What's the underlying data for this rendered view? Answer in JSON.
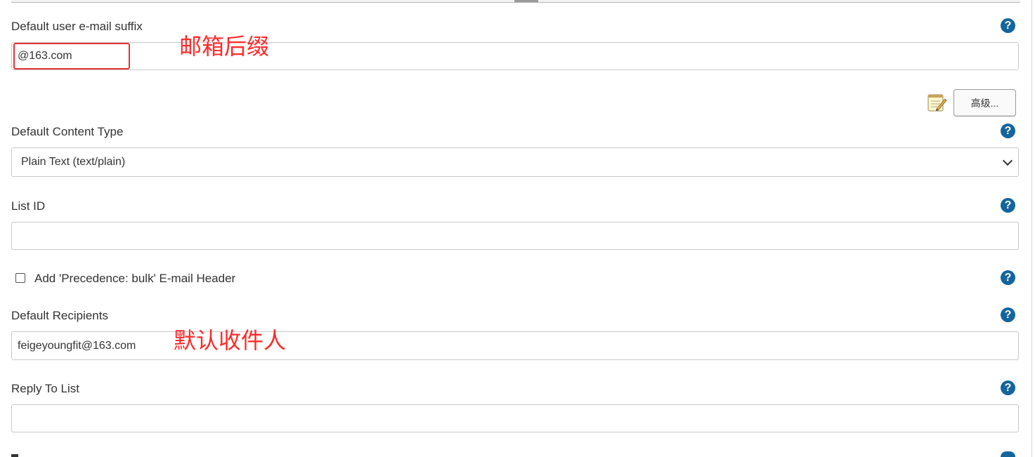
{
  "email_suffix": {
    "label": "Default user e-mail suffix",
    "value": "@163.com",
    "annotation": "邮箱后缀"
  },
  "advanced_button": {
    "label": "高级..."
  },
  "content_type": {
    "label": "Default Content Type",
    "selected": "Plain Text (text/plain)"
  },
  "list_id": {
    "label": "List ID",
    "value": ""
  },
  "precedence": {
    "label": "Add 'Precedence: bulk' E-mail Header",
    "checked": false
  },
  "default_recipients": {
    "label": "Default Recipients",
    "value": "feigeyoungfit@163.com",
    "annotation": "默认收件人"
  },
  "reply_to": {
    "label": "Reply To List",
    "value": ""
  },
  "help_glyph": "?",
  "colors": {
    "help_icon": "#13659d",
    "annotation": "#ff2a2a"
  }
}
